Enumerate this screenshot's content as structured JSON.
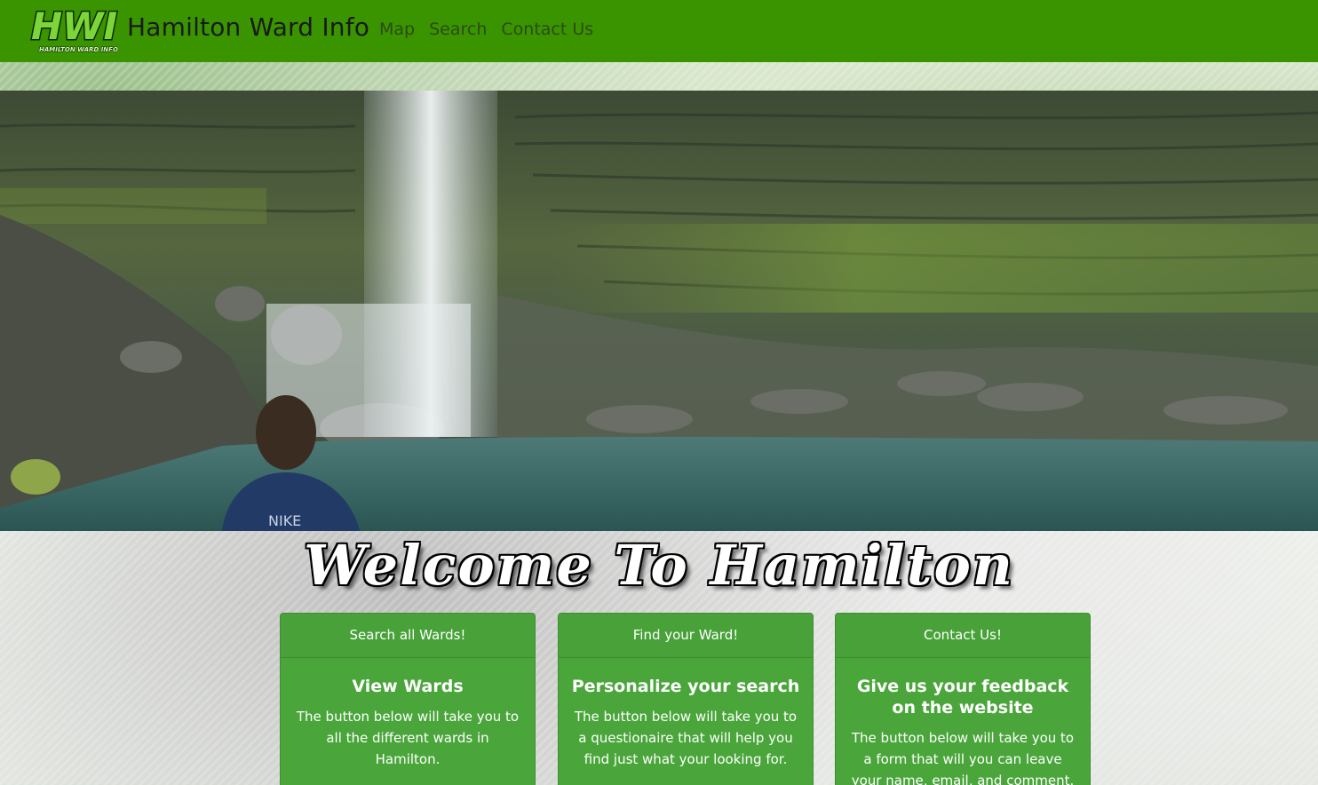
{
  "navbar": {
    "logo_text": "HWI",
    "logo_subtext": "HAMILTON WARD INFO",
    "brand": "Hamilton Ward Info",
    "links": [
      "Map",
      "Search",
      "Contact Us"
    ],
    "bg_color": "#3a9400"
  },
  "hero": {
    "image": "waterfall-photo"
  },
  "welcome": {
    "title": "Welcome To Hamilton"
  },
  "cards": [
    {
      "header": "Search all Wards!",
      "title": "View Wards",
      "text": "The button below will take you to all the different wards in Hamilton."
    },
    {
      "header": "Find your Ward!",
      "title": "Personalize your search",
      "text": "The button below will take you to a questionaire that will help you find just what your looking for."
    },
    {
      "header": "Contact Us!",
      "title": "Give us your feedback on the website",
      "text": "The button below will take you to a form that will you can leave your name, email, and comment."
    }
  ],
  "colors": {
    "accent": "#3a9400",
    "card": "#4aa63b"
  }
}
